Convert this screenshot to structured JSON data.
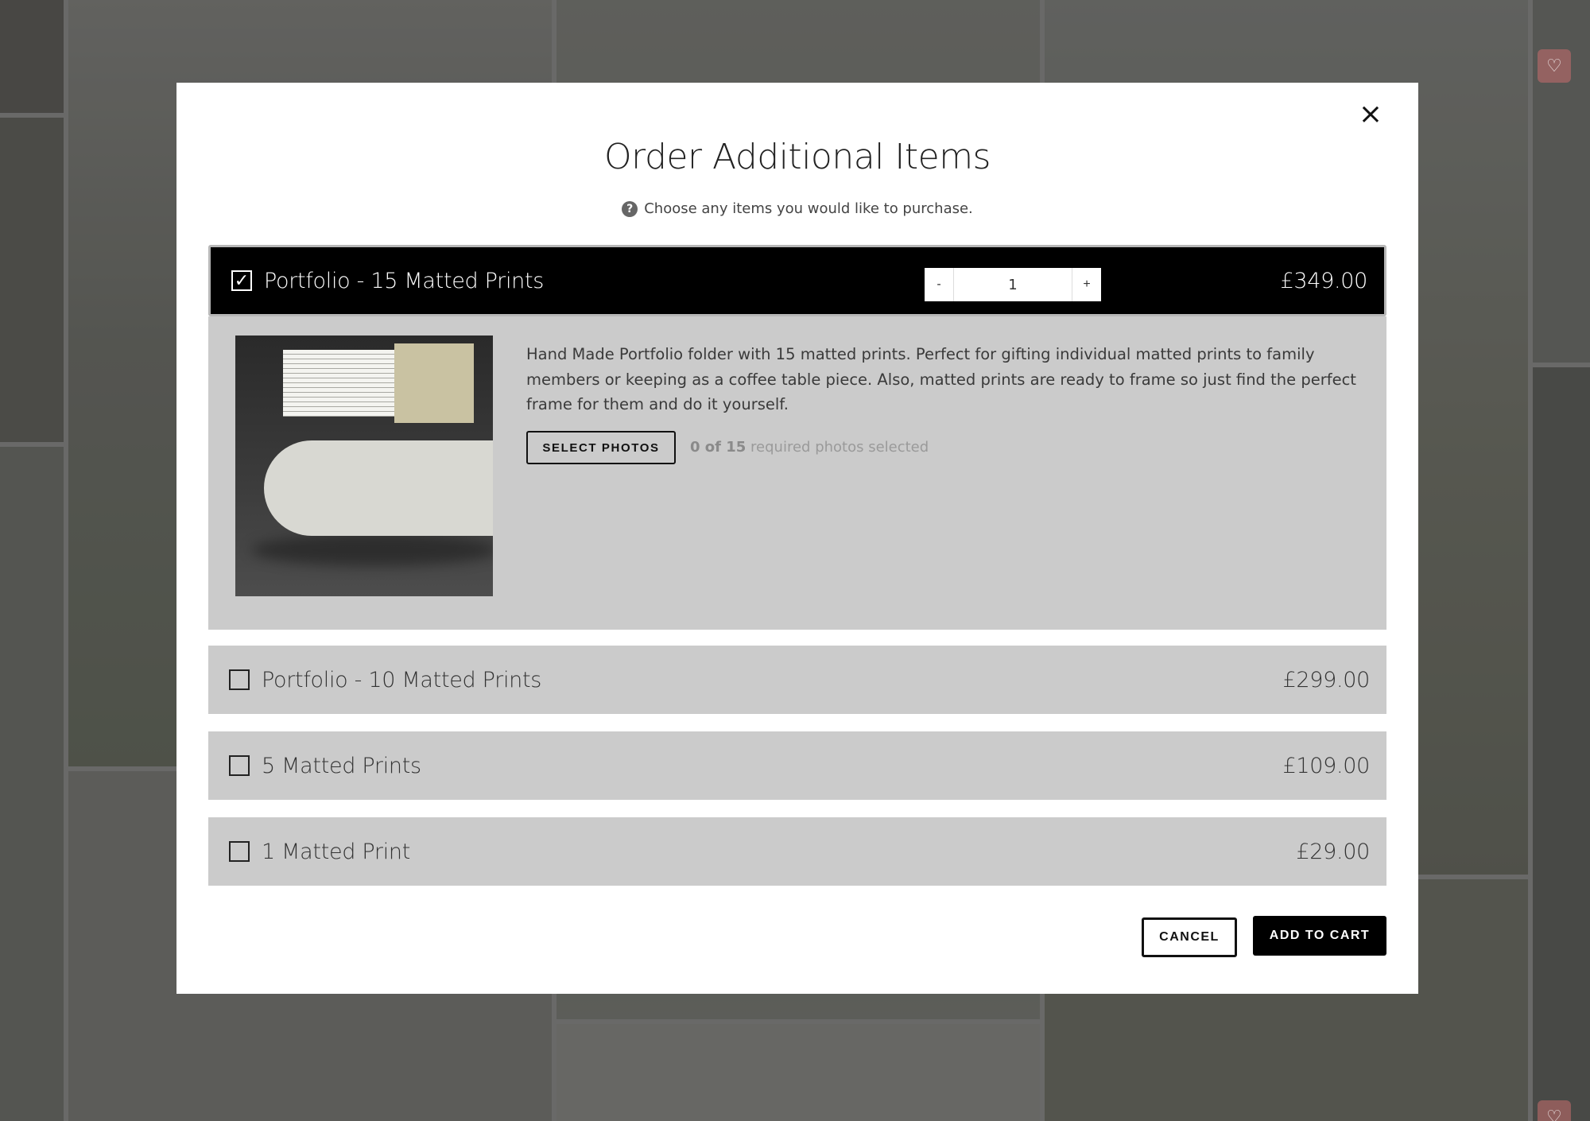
{
  "modal": {
    "title": "Order Additional Items",
    "subtitle": "Choose any items you would like to purchase.",
    "close_label": "×"
  },
  "items": [
    {
      "name": "Portfolio - 15 Matted Prints",
      "price": "£349.00",
      "selected": true,
      "quantity": "1",
      "qty_minus": "-",
      "qty_plus": "+",
      "description": "Hand Made Portfolio folder with 15 matted prints. Perfect for gifting individual matted prints to family members or keeping as a coffee table piece. Also, matted prints are ready to frame so just find the perfect frame for them and do it yourself.",
      "select_photos_label": "SELECT PHOTOS",
      "required_count": "0 of 15",
      "required_text": "required photos selected"
    },
    {
      "name": "Portfolio - 10 Matted Prints",
      "price": "£299.00",
      "selected": false
    },
    {
      "name": "5 Matted Prints",
      "price": "£109.00",
      "selected": false
    },
    {
      "name": "1 Matted Print",
      "price": "£29.00",
      "selected": false
    }
  ],
  "footer": {
    "cancel_label": "CANCEL",
    "add_to_cart_label": "ADD TO CART"
  },
  "icons": {
    "checkbox_checked": "✓",
    "help": "?",
    "heart": "♡"
  }
}
